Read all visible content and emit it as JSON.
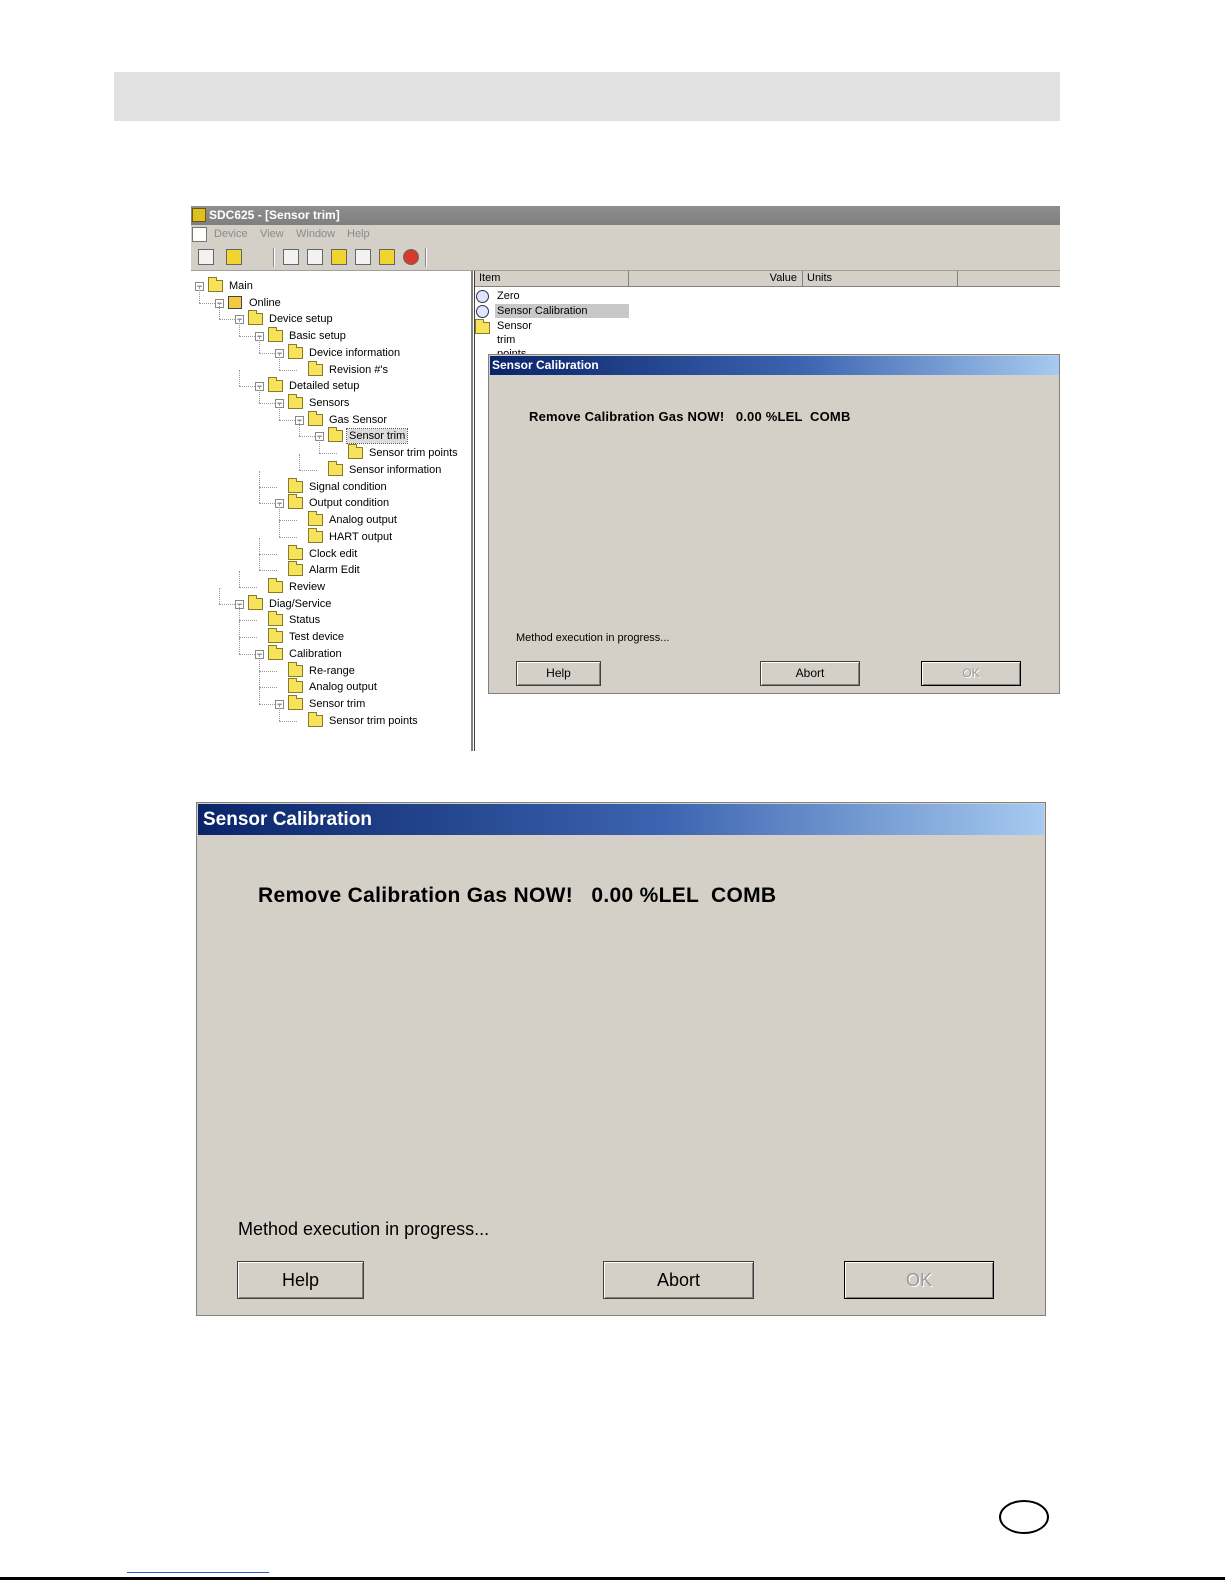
{
  "app": {
    "title": "SDC625 - [Sensor trim]",
    "menu": [
      "Device",
      "View",
      "Window",
      "Help"
    ]
  },
  "tree": [
    {
      "label": "Main",
      "level": 0,
      "expander": "−",
      "icon": "folder-icon"
    },
    {
      "label": "Online",
      "level": 1,
      "expander": "−",
      "icon": "network-icon"
    },
    {
      "label": "Device setup",
      "level": 2,
      "expander": "−",
      "icon": "folder-icon"
    },
    {
      "label": "Basic setup",
      "level": 3,
      "expander": "−",
      "icon": "folder-icon"
    },
    {
      "label": "Device information",
      "level": 4,
      "expander": "−",
      "icon": "folder-icon"
    },
    {
      "label": "Revision #'s",
      "level": 5,
      "expander": "",
      "icon": "folder-icon"
    },
    {
      "label": "Detailed setup",
      "level": 3,
      "expander": "−",
      "icon": "folder-icon"
    },
    {
      "label": "Sensors",
      "level": 4,
      "expander": "−",
      "icon": "folder-icon"
    },
    {
      "label": "Gas Sensor",
      "level": 5,
      "expander": "−",
      "icon": "folder-icon"
    },
    {
      "label": "Sensor trim",
      "level": 6,
      "expander": "−",
      "icon": "open-folder-icon",
      "selected": true
    },
    {
      "label": "Sensor trim points",
      "level": 7,
      "expander": "",
      "icon": "folder-icon"
    },
    {
      "label": "Sensor information",
      "level": 6,
      "expander": "",
      "icon": "folder-icon"
    },
    {
      "label": "Signal condition",
      "level": 4,
      "expander": "",
      "icon": "folder-icon"
    },
    {
      "label": "Output condition",
      "level": 4,
      "expander": "−",
      "icon": "folder-icon"
    },
    {
      "label": "Analog output",
      "level": 5,
      "expander": "",
      "icon": "folder-icon"
    },
    {
      "label": "HART output",
      "level": 5,
      "expander": "",
      "icon": "folder-icon"
    },
    {
      "label": "Clock edit",
      "level": 4,
      "expander": "",
      "icon": "folder-icon"
    },
    {
      "label": "Alarm Edit",
      "level": 4,
      "expander": "",
      "icon": "folder-icon"
    },
    {
      "label": "Review",
      "level": 3,
      "expander": "",
      "icon": "folder-icon"
    },
    {
      "label": "Diag/Service",
      "level": 2,
      "expander": "−",
      "icon": "folder-icon"
    },
    {
      "label": "Status",
      "level": 3,
      "expander": "",
      "icon": "folder-icon"
    },
    {
      "label": "Test device",
      "level": 3,
      "expander": "",
      "icon": "folder-icon"
    },
    {
      "label": "Calibration",
      "level": 3,
      "expander": "−",
      "icon": "folder-icon"
    },
    {
      "label": "Re-range",
      "level": 4,
      "expander": "",
      "icon": "folder-icon"
    },
    {
      "label": "Analog output",
      "level": 4,
      "expander": "",
      "icon": "folder-icon"
    },
    {
      "label": "Sensor trim",
      "level": 4,
      "expander": "−",
      "icon": "folder-icon"
    },
    {
      "label": "Sensor trim points",
      "level": 5,
      "expander": "",
      "icon": "folder-icon"
    }
  ],
  "list": {
    "columns": [
      "Item",
      "Value",
      "Units"
    ],
    "rows": [
      {
        "label": "Zero trim",
        "icon": "method-icon"
      },
      {
        "label": "Sensor Calibration",
        "icon": "method-icon",
        "selected": true
      },
      {
        "label": "Sensor trim points",
        "icon": "folder-icon"
      }
    ]
  },
  "dialog": {
    "title": "Sensor Calibration",
    "message": "Remove Calibration Gas NOW!   0.00 %LEL  COMB",
    "status": "Method execution in progress...",
    "buttons": {
      "help": "Help",
      "abort": "Abort",
      "ok": "OK"
    }
  }
}
